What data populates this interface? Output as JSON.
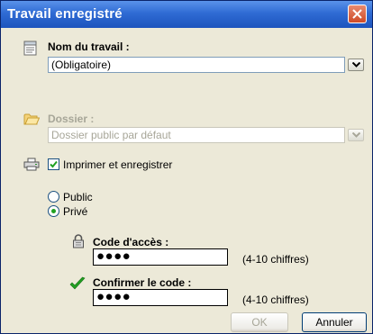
{
  "window": {
    "title": "Travail enregistré"
  },
  "job_name": {
    "label": "Nom du travail :",
    "value": "(Obligatoire)"
  },
  "folder": {
    "label": "Dossier :",
    "value": "Dossier public par défaut"
  },
  "print_and_save": {
    "label": "Imprimer et enregistrer",
    "checked": true
  },
  "privacy": {
    "options": [
      {
        "label": "Public",
        "selected": false
      },
      {
        "label": "Privé",
        "selected": true
      }
    ]
  },
  "access_code": {
    "label": "Code d'accès :",
    "value": "●●●●",
    "hint": "(4-10 chiffres)"
  },
  "confirm_code": {
    "label": "Confirmer le code :",
    "value": "●●●●",
    "hint": "(4-10 chiffres)"
  },
  "buttons": {
    "ok": "OK",
    "cancel": "Annuler"
  },
  "colors": {
    "title_bar": "#2f6bd4",
    "dialog_bg": "#ece9d8",
    "check_mark": "#21a121",
    "close_button": "#cf4a26"
  },
  "icons": [
    "job-document-icon",
    "folder-icon",
    "printer-icon",
    "lock-icon",
    "checkmark-icon"
  ]
}
